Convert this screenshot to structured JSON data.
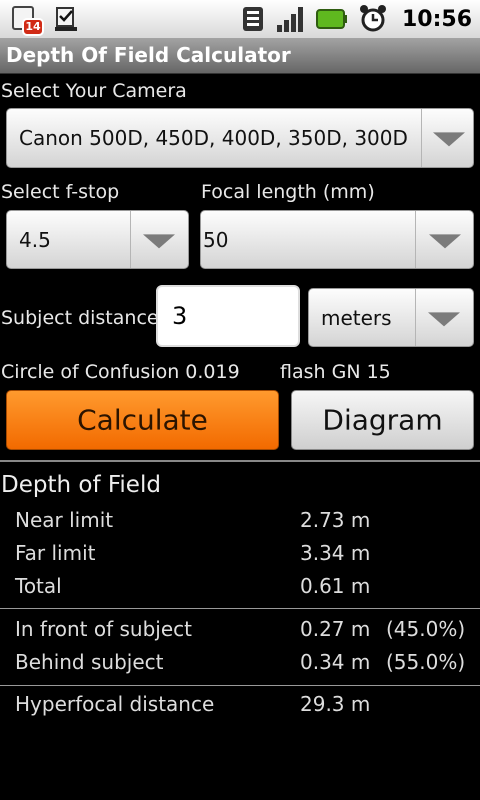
{
  "statusbar": {
    "calendar_badge": "14",
    "time": "10:56"
  },
  "app": {
    "title": "Depth Of Field Calculator"
  },
  "camera": {
    "label": "Select Your Camera",
    "selected": "Canon 500D, 450D, 400D, 350D, 300D"
  },
  "fstop": {
    "label": "Select f-stop",
    "selected": "4.5"
  },
  "focal": {
    "label": "Focal length (mm)",
    "selected": "50"
  },
  "subject": {
    "label": "Subject distance",
    "value": "3",
    "unit": "meters"
  },
  "info": {
    "coc": "Circle of Confusion 0.019",
    "flash": "flash GN 15"
  },
  "buttons": {
    "calculate": "Calculate",
    "diagram": "Diagram"
  },
  "results": {
    "heading": "Depth of Field",
    "near_label": "Near limit",
    "near_value": "2.73 m",
    "far_label": "Far limit",
    "far_value": "3.34 m",
    "total_label": "Total",
    "total_value": "0.61 m",
    "front_label": "In front of subject",
    "front_value": "0.27 m",
    "front_pct": "(45.0%)",
    "behind_label": "Behind subject",
    "behind_value": "0.34 m",
    "behind_pct": "(55.0%)",
    "hyper_label": "Hyperfocal distance",
    "hyper_value": "29.3 m"
  },
  "colors": {
    "accent": "#f57c00",
    "titlebar": "#8a8a8a"
  }
}
